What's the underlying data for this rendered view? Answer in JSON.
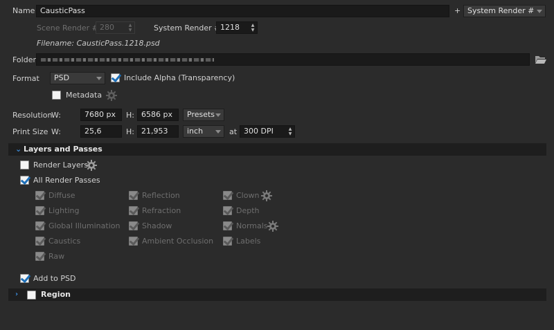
{
  "name": {
    "label": "Name",
    "value": "CausticPass",
    "plus": "+",
    "token": "System Render #"
  },
  "scene_render": {
    "label": "Scene Render #",
    "value": "280"
  },
  "system_render": {
    "label": "System Render #",
    "value": "1218"
  },
  "filename": "Filename: CausticPass.1218.psd",
  "folder": {
    "label": "Folder"
  },
  "format": {
    "label": "Format",
    "value": "PSD",
    "include_alpha": "Include Alpha (Transparency)",
    "metadata": "Metadata"
  },
  "resolution": {
    "label": "Resolution",
    "w_label": "W:",
    "w_value": "7680 px",
    "h_label": "H:",
    "h_value": "6586 px",
    "presets": "Presets"
  },
  "print_size": {
    "label": "Print Size",
    "w_label": "W:",
    "w_value": "25,6",
    "h_label": "H:",
    "h_value": "21,953",
    "unit": "inch",
    "at": "at",
    "dpi": "300 DPI"
  },
  "layers_section": {
    "title": "Layers and Passes",
    "render_layers": "Render Layers",
    "all_render_passes": "All Render Passes",
    "passes": [
      "Diffuse",
      "Lighting",
      "Global Illumination",
      "Caustics",
      "Raw",
      "Reflection",
      "Refraction",
      "Shadow",
      "Ambient Occlusion",
      "Clown",
      "Depth",
      "Normals",
      "Labels"
    ],
    "add_to_psd": "Add to PSD"
  },
  "region_section": {
    "title": "Region"
  }
}
